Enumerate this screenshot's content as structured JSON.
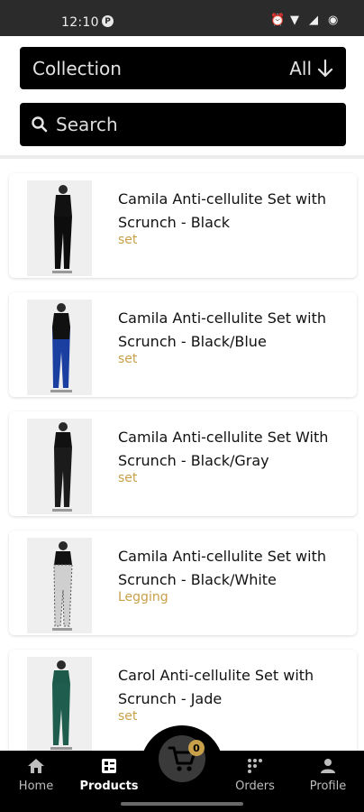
{
  "status_bar": {
    "time": "12:10",
    "app_badge": "P"
  },
  "collection": {
    "label": "Collection",
    "filter_value": "All"
  },
  "search": {
    "placeholder": "Search"
  },
  "products": [
    {
      "title": "Camila Anti-cellulite Set with Scrunch - Black",
      "tag": "set"
    },
    {
      "title": "Camila Anti-cellulite Set with Scrunch - Black/Blue",
      "tag": "set"
    },
    {
      "title": "Camila Anti-cellulite Set With Scrunch - Black/Gray",
      "tag": "set"
    },
    {
      "title": "Camila Anti-cellulite Set with Scrunch - Black/White",
      "tag": "Legging"
    },
    {
      "title": "Carol Anti-cellulite Set with Scrunch - Jade",
      "tag": "set"
    }
  ],
  "nav": {
    "home": "Home",
    "products": "Products",
    "orders": "Orders",
    "profile": "Profile",
    "cart_count": "0"
  },
  "colors": {
    "accent": "#c8a04a",
    "bar": "#000000"
  }
}
